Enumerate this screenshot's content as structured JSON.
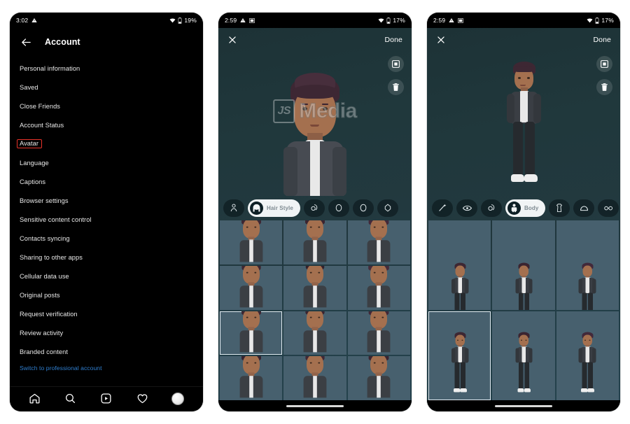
{
  "meta": {
    "watermark_badge": "JS",
    "watermark_text": "Media"
  },
  "phone1": {
    "status": {
      "time": "3:02",
      "battery": "19%",
      "left_icons": [
        "warning-triangle-icon"
      ],
      "right_icons": [
        "wifi-icon",
        "battery-icon"
      ]
    },
    "header": {
      "back": "back-arrow-icon",
      "title": "Account"
    },
    "menu": [
      {
        "label": "Personal information",
        "highlighted": false
      },
      {
        "label": "Saved",
        "highlighted": false
      },
      {
        "label": "Close Friends",
        "highlighted": false
      },
      {
        "label": "Account Status",
        "highlighted": false
      },
      {
        "label": "Avatar",
        "highlighted": true
      },
      {
        "label": "Language",
        "highlighted": false
      },
      {
        "label": "Captions",
        "highlighted": false
      },
      {
        "label": "Browser settings",
        "highlighted": false
      },
      {
        "label": "Sensitive content control",
        "highlighted": false
      },
      {
        "label": "Contacts syncing",
        "highlighted": false
      },
      {
        "label": "Sharing to other apps",
        "highlighted": false
      },
      {
        "label": "Cellular data use",
        "highlighted": false
      },
      {
        "label": "Original posts",
        "highlighted": false
      },
      {
        "label": "Request verification",
        "highlighted": false
      },
      {
        "label": "Review activity",
        "highlighted": false
      },
      {
        "label": "Branded content",
        "highlighted": false
      }
    ],
    "pro_link": "Switch to professional account",
    "tabbar": [
      "home-icon",
      "search-icon",
      "reels-icon",
      "heart-icon",
      "profile-avatar"
    ],
    "highlight_color": "#e8332a",
    "link_color": "#2f7fd0"
  },
  "phone2": {
    "status": {
      "time": "2:59",
      "battery": "17%",
      "left_icons": [
        "warning-triangle-icon",
        "sim-card-icon"
      ],
      "right_icons": [
        "wifi-icon",
        "battery-icon"
      ]
    },
    "header": {
      "close": "close-icon",
      "done_label": "Done"
    },
    "side_actions": [
      "selfie-camera-icon",
      "trash-icon"
    ],
    "categories": [
      {
        "icon": "person-outline-icon",
        "label": "",
        "active": false
      },
      {
        "icon": "hair-style-icon",
        "label": "Hair Style",
        "active": true
      },
      {
        "icon": "hair-color-icon",
        "label": "",
        "active": false
      },
      {
        "icon": "face-shape-icon",
        "label": "",
        "active": false
      },
      {
        "icon": "face-shape-alt-icon",
        "label": "",
        "active": false
      },
      {
        "icon": "head-shape-icon",
        "label": "",
        "active": false
      }
    ],
    "grid": {
      "columns": 3,
      "rows": 4,
      "selected_index": 6,
      "item_type": "avatar-hairstyle-thumbnail"
    }
  },
  "phone3": {
    "status": {
      "time": "2:59",
      "battery": "17%",
      "left_icons": [
        "warning-triangle-icon",
        "sim-card-icon"
      ],
      "right_icons": [
        "wifi-icon",
        "battery-icon"
      ]
    },
    "header": {
      "close": "close-icon",
      "done_label": "Done"
    },
    "side_actions": [
      "selfie-camera-icon",
      "trash-icon"
    ],
    "categories": [
      {
        "icon": "magic-wand-icon",
        "label": "",
        "active": false
      },
      {
        "icon": "eyes-icon",
        "label": "",
        "active": false
      },
      {
        "icon": "eyebrow-icon",
        "label": "",
        "active": false
      },
      {
        "icon": "body-icon",
        "label": "Body",
        "active": true
      },
      {
        "icon": "outfit-icon",
        "label": "",
        "active": false
      },
      {
        "icon": "hat-icon",
        "label": "",
        "active": false
      },
      {
        "icon": "glasses-icon",
        "label": "",
        "active": false
      }
    ],
    "grid": {
      "columns": 3,
      "rows": 3,
      "selected_index": 3,
      "item_type": "avatar-body-thumbnail"
    }
  }
}
